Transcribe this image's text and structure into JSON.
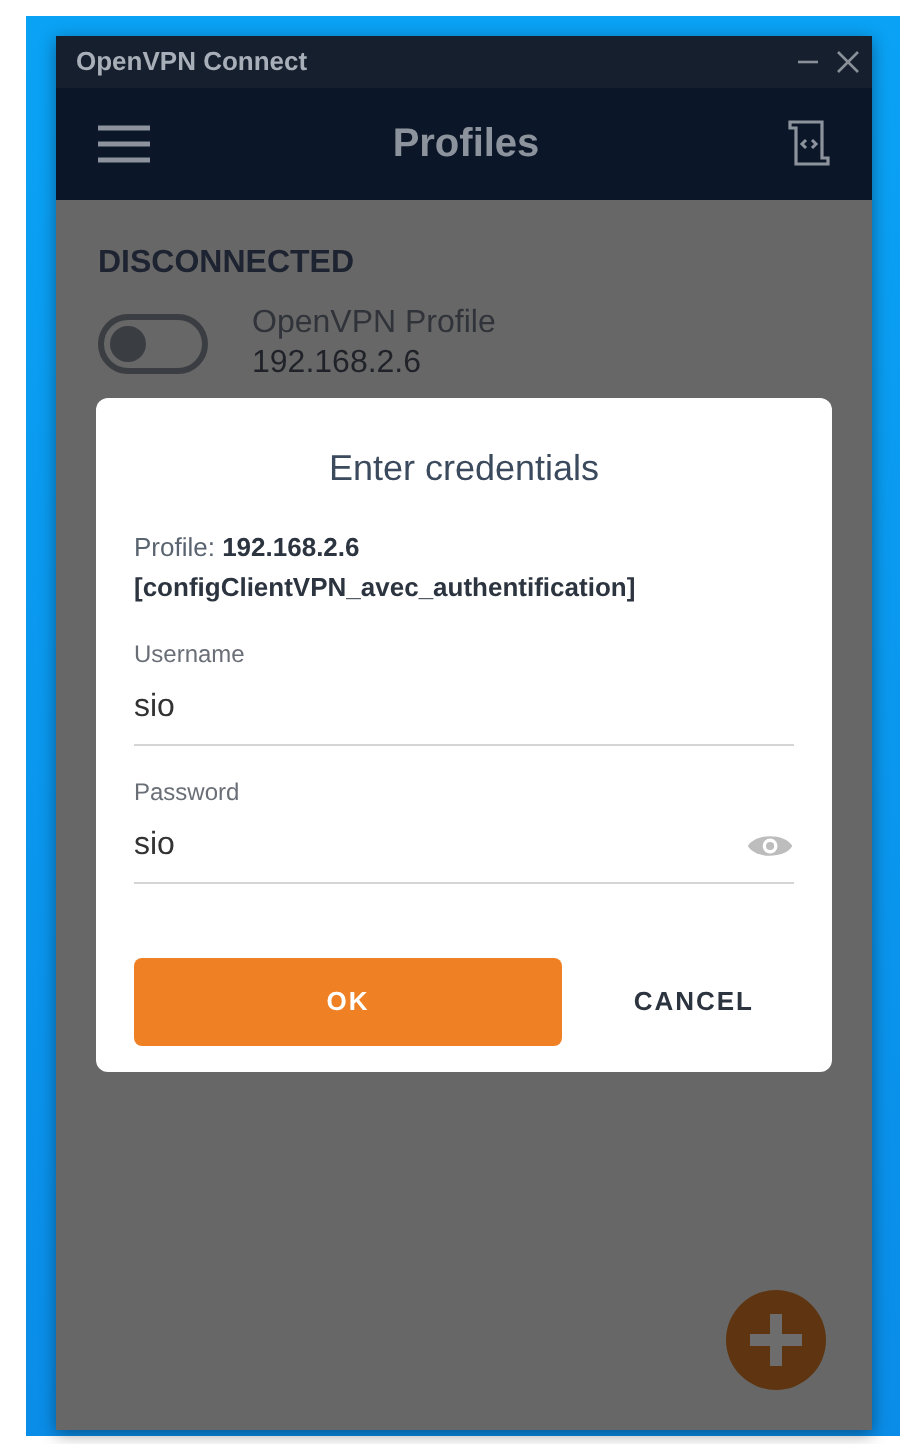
{
  "window": {
    "title": "OpenVPN Connect"
  },
  "header": {
    "title": "Profiles"
  },
  "status": "DISCONNECTED",
  "profiles": [
    {
      "name": "OpenVPN Profile",
      "address": "192.168.2.6",
      "on": false
    }
  ],
  "dialog": {
    "title": "Enter credentials",
    "profile": "Profile: **192.168.2.6 [configClientVPN_avec_authentification]**",
    "fields": [
      {
        "label": "Username",
        "value": "sio",
        "kind": "text"
      },
      {
        "label": "Password",
        "value": "sio",
        "kind": "password"
      }
    ],
    "buttons": [
      {
        "label": "OK",
        "kind": "primary"
      },
      {
        "label": "CANCEL",
        "kind": "text"
      }
    ]
  }
}
